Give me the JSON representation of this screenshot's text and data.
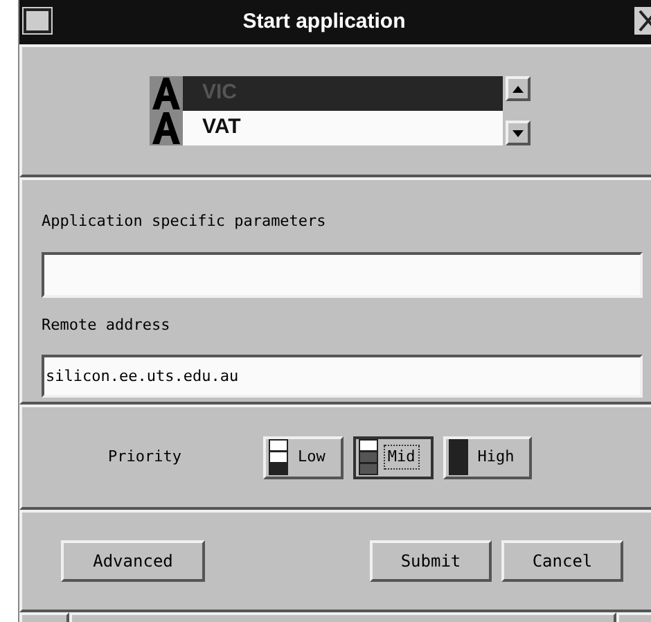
{
  "window": {
    "title": "Start application"
  },
  "applications": [
    {
      "name": "VIC",
      "selected": true
    },
    {
      "name": "VAT",
      "selected": false
    }
  ],
  "parameters": {
    "label": "Application specific parameters"
  },
  "remote_address": {
    "label": "Remote address",
    "value": "silicon.ee.uts.edu.au"
  },
  "priority": {
    "label": "Priority",
    "options": [
      {
        "label": "Low",
        "kind": "low",
        "selected": false
      },
      {
        "label": "Mid",
        "kind": "mid",
        "selected": true
      },
      {
        "label": "High",
        "kind": "high",
        "selected": false
      }
    ]
  },
  "buttons": {
    "left": [
      "Advanced"
    ],
    "right": [
      "Submit",
      "Cancel"
    ]
  }
}
